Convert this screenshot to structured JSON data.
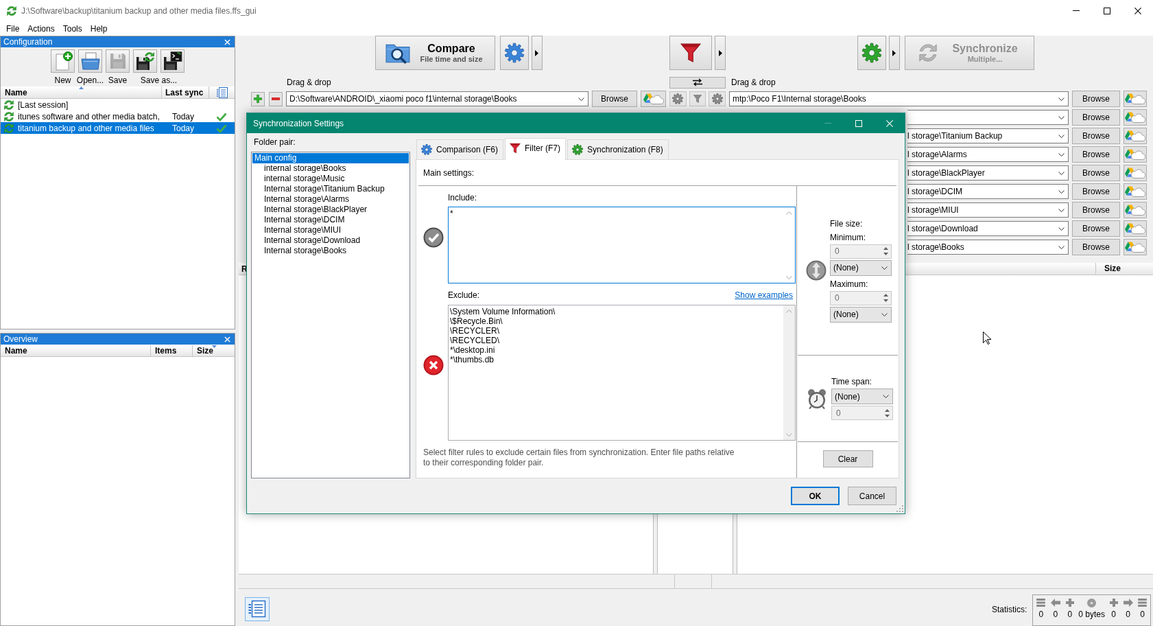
{
  "window": {
    "title": "J:\\Software\\backup\\titanium backup and other media files.ffs_gui",
    "buttons": [
      {
        "kind": "minimize",
        "disabled": false
      },
      {
        "kind": "maximize",
        "disabled": false
      },
      {
        "kind": "close",
        "disabled": false
      }
    ]
  },
  "menu": [
    {
      "label": "File"
    },
    {
      "label": "Actions"
    },
    {
      "label": "Tools"
    },
    {
      "label": "Help"
    }
  ],
  "configuration_panel": {
    "title": "Configuration",
    "toolbar": [
      {
        "kind": "new",
        "label": "New",
        "disabled": false
      },
      {
        "kind": "open",
        "label": "Open...",
        "disabled": false
      },
      {
        "kind": "save",
        "label": "Save",
        "disabled": true
      },
      {
        "kind": "save_as",
        "label": "Save as...",
        "disabled": false
      },
      {
        "kind": "save_as_batch",
        "disabled": false
      }
    ],
    "columns": [
      {
        "label": "Name",
        "sorted": true,
        "descending": false
      },
      {
        "label": "Last sync",
        "sorted": false
      }
    ],
    "rows": [
      {
        "name": "[Last session]",
        "selected": false,
        "sync_ok": false
      },
      {
        "name": "itunes software and other media batch,",
        "last_sync": "Today",
        "selected": false,
        "sync_ok": true
      },
      {
        "name": "titanium backup and other media files",
        "last_sync": "Today",
        "selected": true,
        "sync_ok": true
      }
    ]
  },
  "overview_panel": {
    "title": "Overview",
    "columns": [
      {
        "label": "Name",
        "sorted": false
      },
      {
        "label": "Items",
        "sorted": false
      },
      {
        "label": "Size",
        "sorted": true,
        "descending": true
      }
    ]
  },
  "toolbar": {
    "compare": {
      "label": "Compare",
      "sublabel": "File time and size",
      "disabled": false
    },
    "synchronize": {
      "label": "Synchronize",
      "sublabel": "Multiple...",
      "disabled": true
    }
  },
  "folder_pairs": {
    "left_header": "Drag & drop",
    "right_header": "Drag & drop",
    "rows": [
      {
        "left": {
          "path": "D:\\Software\\ANDROID\\_xiaomi poco f1\\internal storage\\Books",
          "browse": "Browse"
        },
        "right": {
          "path": "mtp:\\Poco F1\\Internal storage\\Books",
          "browse": "Browse"
        }
      },
      {
        "right": {
          "browse": "Browse"
        }
      },
      {
        "right": {
          "path": "l storage\\Titanium Backup",
          "browse": "Browse"
        }
      },
      {
        "right": {
          "path": "l storage\\Alarms",
          "browse": "Browse"
        }
      },
      {
        "right": {
          "path": "l storage\\BlackPlayer",
          "browse": "Browse"
        }
      },
      {
        "right": {
          "path": "l storage\\DCIM",
          "browse": "Browse"
        }
      },
      {
        "right": {
          "path": "l storage\\MIUI",
          "browse": "Browse"
        }
      },
      {
        "right": {
          "path": "l storage\\Download",
          "browse": "Browse"
        }
      },
      {
        "right": {
          "path": "l storage\\Books",
          "browse": "Browse"
        }
      }
    ]
  },
  "left_grid": {
    "columns": [
      "R"
    ]
  },
  "right_grid": {
    "columns": [
      "Size"
    ]
  },
  "statistics": {
    "label": "Statistics:",
    "items": [
      {
        "kind": "delete_left",
        "value": "0"
      },
      {
        "kind": "update_left",
        "value": "0"
      },
      {
        "kind": "create_left",
        "value": "0"
      },
      {
        "kind": "data",
        "value": "0 bytes"
      },
      {
        "kind": "create_right",
        "value": "0"
      },
      {
        "kind": "update_right",
        "value": "0"
      },
      {
        "kind": "delete_right",
        "value": "0"
      }
    ]
  },
  "dialog": {
    "title": "Synchronization Settings",
    "window_buttons": [
      {
        "kind": "minimize",
        "disabled": true
      },
      {
        "kind": "maximize",
        "disabled": false
      },
      {
        "kind": "close",
        "disabled": false
      }
    ],
    "folder_pair_label": "Folder pair:",
    "folder_pairs": [
      {
        "label": "Main config",
        "selected": true,
        "children": [
          {
            "label": "internal storage\\Books",
            "selected": false
          },
          {
            "label": "internal storage\\Music",
            "selected": false
          },
          {
            "label": "Internal storage\\Titanium Backup",
            "selected": false
          },
          {
            "label": "Internal storage\\Alarms",
            "selected": false
          },
          {
            "label": "Internal storage\\BlackPlayer",
            "selected": false
          },
          {
            "label": "Internal storage\\DCIM",
            "selected": false
          },
          {
            "label": "Internal storage\\MIUI",
            "selected": false
          },
          {
            "label": "Internal storage\\Download",
            "selected": false
          },
          {
            "label": "Internal storage\\Books",
            "selected": false
          }
        ]
      }
    ],
    "tabs": [
      {
        "kind": "comparison",
        "label": "Comparison (F6)",
        "selected": false
      },
      {
        "kind": "filter",
        "label": "Filter (F7)",
        "selected": true
      },
      {
        "kind": "synchronization",
        "label": "Synchronization (F8)",
        "selected": false
      }
    ],
    "filter": {
      "heading": "Main settings:",
      "include_label": "Include:",
      "include": [
        "*"
      ],
      "include_focused": true,
      "exclude_label": "Exclude:",
      "show_examples_link": "Show examples",
      "exclude": [
        "\\System Volume Information\\",
        "\\$Recycle.Bin\\",
        "\\RECYCLER\\",
        "\\RECYCLED\\",
        "*\\desktop.ini",
        "*\\thumbs.db"
      ],
      "hint": "Select filter rules to exclude certain files from synchronization. Enter file paths relative to their corresponding folder pair.",
      "file_size_label": "File size:",
      "minimum_label": "Minimum:",
      "minimum": {
        "value": "0",
        "disabled": true
      },
      "minimum_unit": "(None)",
      "maximum_label": "Maximum:",
      "maximum": {
        "value": "0",
        "disabled": true
      },
      "maximum_unit": "(None)",
      "time_span_label": "Time span:",
      "time_span": "(None)",
      "time_span_value": {
        "value": "0",
        "disabled": true
      },
      "clear_button": "Clear"
    },
    "buttons": [
      {
        "label": "OK",
        "default": true
      },
      {
        "label": "Cancel",
        "default": false
      }
    ]
  }
}
